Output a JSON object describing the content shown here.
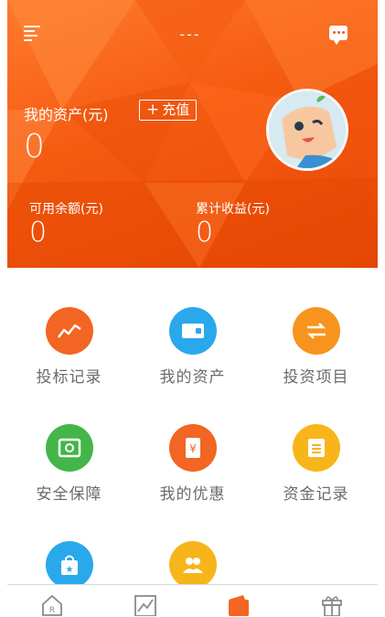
{
  "header": {
    "title": "---",
    "assets_label": "我的资产(元)",
    "recharge_label": "充值",
    "total_assets": "0",
    "available_label": "可用余额(元)",
    "available_value": "0",
    "earnings_label": "累计收益(元)",
    "earnings_value": "0"
  },
  "grid": {
    "items": [
      {
        "label": "投标记录",
        "icon": "trend-chart-icon",
        "color": "#f26522"
      },
      {
        "label": "我的资产",
        "icon": "wallet-icon",
        "color": "#2aa8ec"
      },
      {
        "label": "投资项目",
        "icon": "exchange-arrows-icon",
        "color": "#f7941d"
      },
      {
        "label": "安全保障",
        "icon": "safe-icon",
        "color": "#43b649"
      },
      {
        "label": "我的优惠",
        "icon": "coupon-icon",
        "color": "#f26522"
      },
      {
        "label": "资金记录",
        "icon": "ledger-icon",
        "color": "#f7b51b"
      },
      {
        "label": "",
        "icon": "shopping-bag-icon",
        "color": "#2aa8ec"
      },
      {
        "label": "",
        "icon": "users-icon",
        "color": "#f7b51b"
      }
    ]
  },
  "tabbar": {
    "tabs": [
      {
        "icon": "home-icon"
      },
      {
        "icon": "chart-icon"
      },
      {
        "icon": "wallet-tab-icon",
        "active": true
      },
      {
        "icon": "gift-icon"
      }
    ]
  }
}
